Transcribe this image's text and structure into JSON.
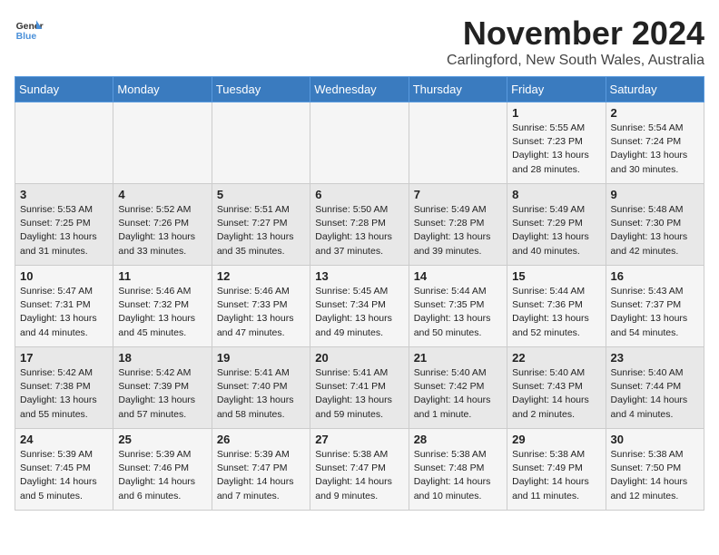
{
  "logo": {
    "line1": "General",
    "line2": "Blue"
  },
  "title": "November 2024",
  "location": "Carlingford, New South Wales, Australia",
  "weekdays": [
    "Sunday",
    "Monday",
    "Tuesday",
    "Wednesday",
    "Thursday",
    "Friday",
    "Saturday"
  ],
  "weeks": [
    [
      {
        "day": "",
        "info": ""
      },
      {
        "day": "",
        "info": ""
      },
      {
        "day": "",
        "info": ""
      },
      {
        "day": "",
        "info": ""
      },
      {
        "day": "",
        "info": ""
      },
      {
        "day": "1",
        "info": "Sunrise: 5:55 AM\nSunset: 7:23 PM\nDaylight: 13 hours\nand 28 minutes."
      },
      {
        "day": "2",
        "info": "Sunrise: 5:54 AM\nSunset: 7:24 PM\nDaylight: 13 hours\nand 30 minutes."
      }
    ],
    [
      {
        "day": "3",
        "info": "Sunrise: 5:53 AM\nSunset: 7:25 PM\nDaylight: 13 hours\nand 31 minutes."
      },
      {
        "day": "4",
        "info": "Sunrise: 5:52 AM\nSunset: 7:26 PM\nDaylight: 13 hours\nand 33 minutes."
      },
      {
        "day": "5",
        "info": "Sunrise: 5:51 AM\nSunset: 7:27 PM\nDaylight: 13 hours\nand 35 minutes."
      },
      {
        "day": "6",
        "info": "Sunrise: 5:50 AM\nSunset: 7:28 PM\nDaylight: 13 hours\nand 37 minutes."
      },
      {
        "day": "7",
        "info": "Sunrise: 5:49 AM\nSunset: 7:28 PM\nDaylight: 13 hours\nand 39 minutes."
      },
      {
        "day": "8",
        "info": "Sunrise: 5:49 AM\nSunset: 7:29 PM\nDaylight: 13 hours\nand 40 minutes."
      },
      {
        "day": "9",
        "info": "Sunrise: 5:48 AM\nSunset: 7:30 PM\nDaylight: 13 hours\nand 42 minutes."
      }
    ],
    [
      {
        "day": "10",
        "info": "Sunrise: 5:47 AM\nSunset: 7:31 PM\nDaylight: 13 hours\nand 44 minutes."
      },
      {
        "day": "11",
        "info": "Sunrise: 5:46 AM\nSunset: 7:32 PM\nDaylight: 13 hours\nand 45 minutes."
      },
      {
        "day": "12",
        "info": "Sunrise: 5:46 AM\nSunset: 7:33 PM\nDaylight: 13 hours\nand 47 minutes."
      },
      {
        "day": "13",
        "info": "Sunrise: 5:45 AM\nSunset: 7:34 PM\nDaylight: 13 hours\nand 49 minutes."
      },
      {
        "day": "14",
        "info": "Sunrise: 5:44 AM\nSunset: 7:35 PM\nDaylight: 13 hours\nand 50 minutes."
      },
      {
        "day": "15",
        "info": "Sunrise: 5:44 AM\nSunset: 7:36 PM\nDaylight: 13 hours\nand 52 minutes."
      },
      {
        "day": "16",
        "info": "Sunrise: 5:43 AM\nSunset: 7:37 PM\nDaylight: 13 hours\nand 54 minutes."
      }
    ],
    [
      {
        "day": "17",
        "info": "Sunrise: 5:42 AM\nSunset: 7:38 PM\nDaylight: 13 hours\nand 55 minutes."
      },
      {
        "day": "18",
        "info": "Sunrise: 5:42 AM\nSunset: 7:39 PM\nDaylight: 13 hours\nand 57 minutes."
      },
      {
        "day": "19",
        "info": "Sunrise: 5:41 AM\nSunset: 7:40 PM\nDaylight: 13 hours\nand 58 minutes."
      },
      {
        "day": "20",
        "info": "Sunrise: 5:41 AM\nSunset: 7:41 PM\nDaylight: 13 hours\nand 59 minutes."
      },
      {
        "day": "21",
        "info": "Sunrise: 5:40 AM\nSunset: 7:42 PM\nDaylight: 14 hours\nand 1 minute."
      },
      {
        "day": "22",
        "info": "Sunrise: 5:40 AM\nSunset: 7:43 PM\nDaylight: 14 hours\nand 2 minutes."
      },
      {
        "day": "23",
        "info": "Sunrise: 5:40 AM\nSunset: 7:44 PM\nDaylight: 14 hours\nand 4 minutes."
      }
    ],
    [
      {
        "day": "24",
        "info": "Sunrise: 5:39 AM\nSunset: 7:45 PM\nDaylight: 14 hours\nand 5 minutes."
      },
      {
        "day": "25",
        "info": "Sunrise: 5:39 AM\nSunset: 7:46 PM\nDaylight: 14 hours\nand 6 minutes."
      },
      {
        "day": "26",
        "info": "Sunrise: 5:39 AM\nSunset: 7:47 PM\nDaylight: 14 hours\nand 7 minutes."
      },
      {
        "day": "27",
        "info": "Sunrise: 5:38 AM\nSunset: 7:47 PM\nDaylight: 14 hours\nand 9 minutes."
      },
      {
        "day": "28",
        "info": "Sunrise: 5:38 AM\nSunset: 7:48 PM\nDaylight: 14 hours\nand 10 minutes."
      },
      {
        "day": "29",
        "info": "Sunrise: 5:38 AM\nSunset: 7:49 PM\nDaylight: 14 hours\nand 11 minutes."
      },
      {
        "day": "30",
        "info": "Sunrise: 5:38 AM\nSunset: 7:50 PM\nDaylight: 14 hours\nand 12 minutes."
      }
    ]
  ]
}
